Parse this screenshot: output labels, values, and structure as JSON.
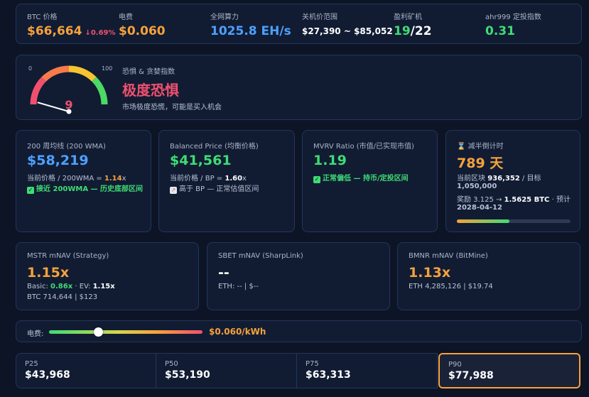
{
  "top": {
    "btc_label": "BTC 价格",
    "btc_price": "$66,664",
    "btc_change": "↓0.69%",
    "elec_label": "电费",
    "elec_value": "$0.060",
    "hash_label": "全网算力",
    "hash_value": "1025.8 EH/s",
    "shutdown_label": "关机价范围",
    "shutdown_value": "$27,390 ~ $85,052",
    "miners_label": "盈利矿机",
    "miners_profitable": "19",
    "miners_total": "/22",
    "ahr_label": "ahr999 定投指数",
    "ahr_value": "0.31"
  },
  "fear_greed": {
    "title": "恐惧 & 贪婪指数",
    "status": "极度恐惧",
    "description": "市场极度恐慌，可能是买入机会",
    "value": 9,
    "value_text": "9",
    "min_label": "0",
    "max_label": "100"
  },
  "wma": {
    "title": "200 周均线 (200 WMA)",
    "price": "$58,219",
    "ratio_prefix": "当前价格 / 200WMA = ",
    "ratio_value": "1.14",
    "ratio_suffix": "x",
    "status": "接近 200WMA — 历史底部区间"
  },
  "bp": {
    "title": "Balanced Price (均衡价格)",
    "price": "$41,561",
    "ratio_prefix": "当前价格 / BP = ",
    "ratio_value": "1.60",
    "ratio_suffix": "x",
    "status": "高于 BP — 正常估值区间"
  },
  "mvrv": {
    "title": "MVRV Ratio (市值/已实现市值)",
    "value": "1.19",
    "status": "正常偏低 — 持币/定投区间"
  },
  "halving": {
    "title": "减半倒计时",
    "days": "789 天",
    "block_prefix": "当前区块 ",
    "block_current": "936,352",
    "block_mid": " / 目标",
    "block_target": "1,050,000",
    "reward_prefix": "奖励 3.125 → ",
    "reward_next": "1.5625 BTC",
    "reward_suffix": " · 预计",
    "date": "2028-04-12",
    "progress": 0.46
  },
  "mstr": {
    "title": "MSTR mNAV (Strategy)",
    "value": "1.15x",
    "basic_label": "Basic: ",
    "basic_value": "0.86x",
    "ev_label": " · EV: ",
    "ev_value": "1.15x",
    "holdings": "BTC 714,644 | $123"
  },
  "sbet": {
    "title": "SBET mNAV (SharpLink)",
    "value": "--",
    "holdings": "ETH: -- | $--"
  },
  "bmnr": {
    "title": "BMNR mNAV (BitMine)",
    "value": "1.13x",
    "holdings": "ETH 4,285,126 | $19.74"
  },
  "electricity_slider": {
    "label": "电费:",
    "value_text": "$0.060/kWh",
    "position": 0.32
  },
  "percentiles": [
    {
      "label": "P25",
      "value": "$43,968"
    },
    {
      "label": "P50",
      "value": "$53,190"
    },
    {
      "label": "P75",
      "value": "$63,313"
    },
    {
      "label": "P90",
      "value": "$77,988"
    }
  ],
  "colors": {
    "background": "#0c1426",
    "card": "#111c33",
    "border": "#22365a",
    "accent_orange": "#f7a23b",
    "accent_blue": "#4ea1ff",
    "accent_green": "#3fdc74",
    "accent_red": "#f0506e"
  }
}
